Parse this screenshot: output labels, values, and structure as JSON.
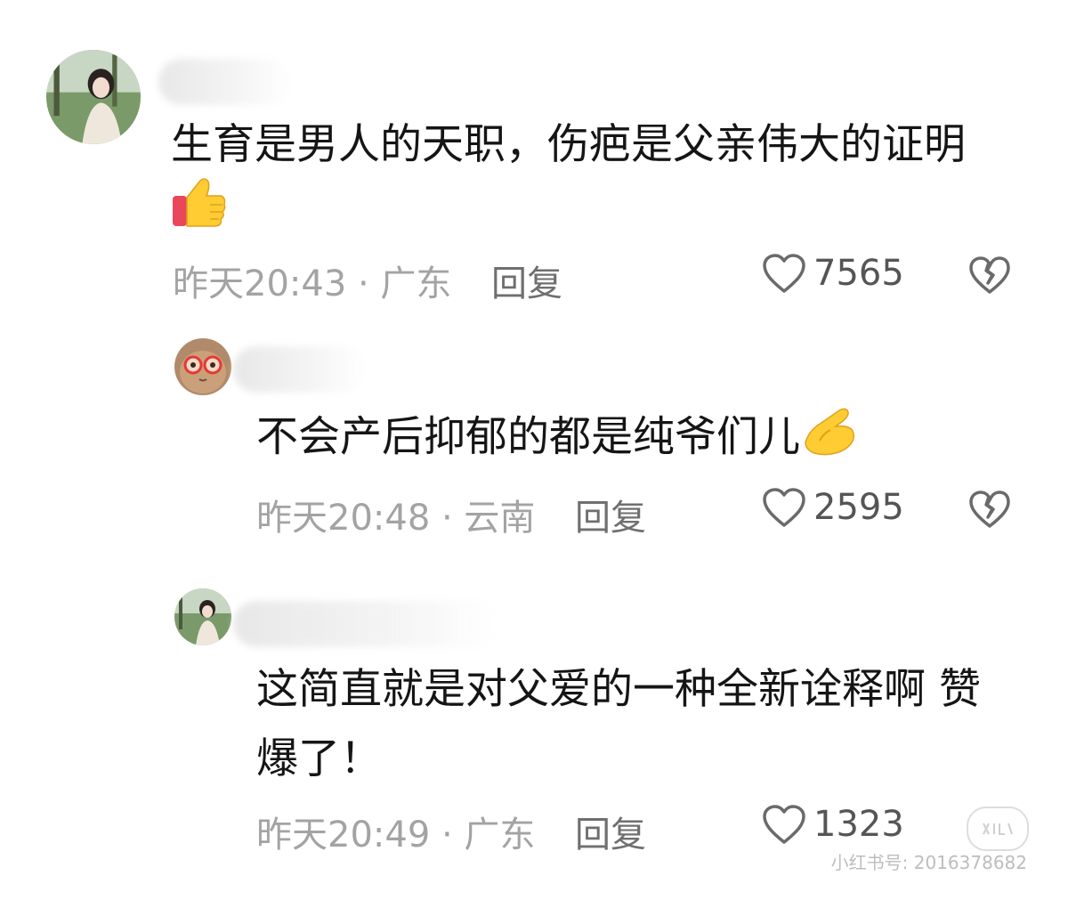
{
  "comments": [
    {
      "text": "生育是男人的天职，伤疤是父亲伟大的证明",
      "emoji": "thumbs-up",
      "time": "昨天20:43 · 广东",
      "reply_label": "回复",
      "likes": "7565"
    },
    {
      "text": "不会产后抑郁的都是纯爷们儿",
      "emoji": "pinching-hand",
      "time": "昨天20:48 · 云南",
      "reply_label": "回复",
      "likes": "2595"
    },
    {
      "text_line1": "这简直就是对父爱的一种全新诠释啊 赞",
      "text_line2": "爆了！",
      "time": "昨天20:49 · 广东",
      "reply_label": "回复",
      "likes": "1323"
    }
  ],
  "watermark": {
    "text": "小红书号: 2016378682"
  },
  "icons": {
    "like": "heart-outline-icon",
    "dislike": "broken-heart-icon"
  },
  "colors": {
    "meta_text": "#a3a3a3",
    "reply_text": "#6f6f6f",
    "icon_stroke": "#6a6a6a"
  }
}
